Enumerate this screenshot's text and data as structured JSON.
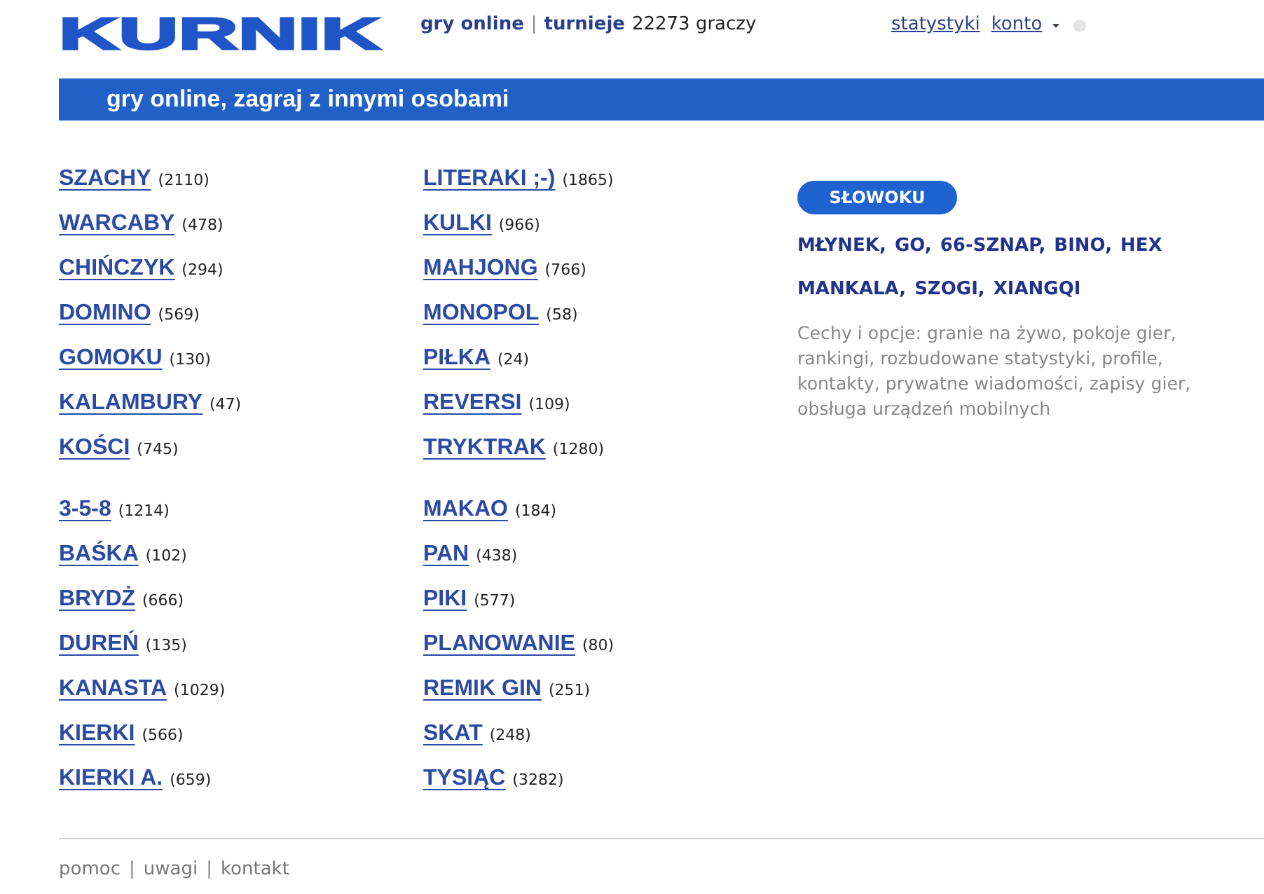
{
  "logo": {
    "text": "KURNIK"
  },
  "header": {
    "nav": [
      {
        "kind": "link",
        "text": "gry online"
      },
      {
        "kind": "separator",
        "text": "|"
      },
      {
        "kind": "link",
        "text": "turnieje"
      },
      {
        "kind": "text",
        "text": "22273 graczy"
      }
    ],
    "account": [
      {
        "kind": "link",
        "text": "statystyki"
      },
      {
        "kind": "menu",
        "text": "konto"
      }
    ]
  },
  "banner": {
    "title": "gry online, zagraj z innymi osobami"
  },
  "games": {
    "columns": [
      {
        "groups": [
          {
            "items": [
              {
                "name": "SZACHY",
                "count": "(2110)"
              },
              {
                "name": "WARCABY",
                "count": "(478)"
              },
              {
                "name": "CHIŃCZYK",
                "count": "(294)"
              },
              {
                "name": "DOMINO",
                "count": "(569)"
              },
              {
                "name": "GOMOKU",
                "count": "(130)"
              },
              {
                "name": "KALAMBURY",
                "count": "(47)"
              },
              {
                "name": "KOŚCI",
                "count": "(745)"
              }
            ]
          },
          {
            "items": [
              {
                "name": "3-5-8",
                "count": "(1214)"
              },
              {
                "name": "BAŚKA",
                "count": "(102)"
              },
              {
                "name": "BRYDŻ",
                "count": "(666)"
              },
              {
                "name": "DUREŃ",
                "count": "(135)"
              },
              {
                "name": "KANASTA",
                "count": "(1029)"
              },
              {
                "name": "KIERKI",
                "count": "(566)"
              },
              {
                "name": "KIERKI A.",
                "count": "(659)"
              }
            ]
          }
        ]
      },
      {
        "groups": [
          {
            "items": [
              {
                "name": "LITERAKI ;-)",
                "count": "(1865)"
              },
              {
                "name": "KULKI",
                "count": "(966)"
              },
              {
                "name": "MAHJONG",
                "count": "(766)"
              },
              {
                "name": "MONOPOL",
                "count": "(58)"
              },
              {
                "name": "PIŁKA",
                "count": "(24)"
              },
              {
                "name": "REVERSI",
                "count": "(109)"
              },
              {
                "name": "TRYKTRAK",
                "count": "(1280)"
              }
            ]
          },
          {
            "items": [
              {
                "name": "MAKAO",
                "count": "(184)"
              },
              {
                "name": "PAN",
                "count": "(438)"
              },
              {
                "name": "PIKI",
                "count": "(577)"
              },
              {
                "name": "PLANOWANIE",
                "count": "(80)"
              },
              {
                "name": "REMIK GIN",
                "count": "(251)"
              },
              {
                "name": "SKAT",
                "count": "(248)"
              },
              {
                "name": "TYSIĄC",
                "count": "(3282)"
              }
            ]
          }
        ]
      }
    ]
  },
  "featured": {
    "button": "SŁOWOKU",
    "separator": ",",
    "rows": [
      {
        "links": [
          "MŁYNEK",
          "GO",
          "66-SZNAP",
          "BINO",
          "HEX"
        ]
      },
      {
        "links": [
          "MANKALA",
          "SZOGI",
          "XIANGQI"
        ]
      }
    ],
    "description": "Cechy i opcje: granie na żywo, pokoje gier, rankingi, rozbudowane statystyki, profile, kontakty, prywatne wiadomości, zapisy gier, obsługa urządzeń mobilnych"
  },
  "footer": {
    "separator": "|",
    "links": [
      "pomoc",
      "uwagi",
      "kontakt"
    ]
  }
}
